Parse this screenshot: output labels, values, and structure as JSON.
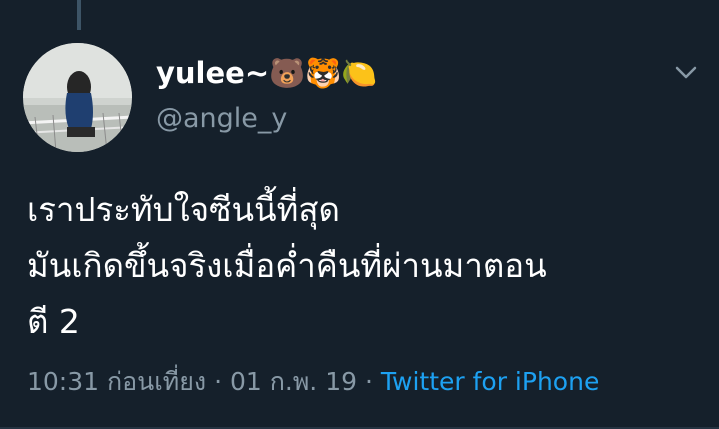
{
  "tweet": {
    "display_name": "yulee~🐻🐯🍋",
    "handle": "@angle_y",
    "text_lines": [
      "เราประทับใจซีนนี้ที่สุด",
      "มันเกิดขึ้นจริงเมื่อค่ำคืนที่ผ่านมาตอน",
      "ตี 2"
    ],
    "time": "10:31 ก่อนเที่ยง",
    "separator": "·",
    "date": "01 ก.พ. 19",
    "source": "Twitter for iPhone"
  },
  "colors": {
    "background": "#15202b",
    "primary_text": "#ffffff",
    "secondary_text": "#8899a6",
    "accent": "#1da1f2",
    "thread_line": "#3d5466"
  },
  "icons": {
    "menu": "chevron-down-icon"
  }
}
